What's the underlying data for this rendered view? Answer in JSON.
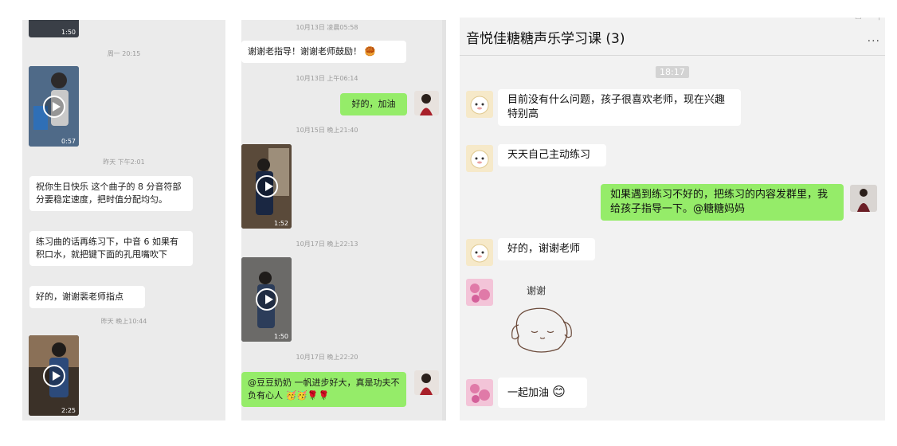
{
  "panel1": {
    "video_top": {
      "duration": "1:50"
    },
    "ts1": "周一 20:15",
    "video_a": {
      "duration": "0:57"
    },
    "ts2": "昨天 下午2:01",
    "msg1": "祝你生日快乐  这个曲子的 8 分音符部分要稳定速度，把时值分配均匀。",
    "msg2": "练习曲的话再练习下，中音 6 如果有积口水，就把键下面的孔甩嘴吹下",
    "msg3": "好的，谢谢裴老师指点",
    "ts3": "昨天 晚上10:44",
    "video_b": {
      "duration": "2:25"
    }
  },
  "panel2": {
    "ts1": "10月13日 凌晨05:58",
    "msg1": "谢谢老指导！谢谢老师鼓励！",
    "msg1_emoji": "🥮",
    "ts2": "10月13日 上午06:14",
    "msg2": "好的，加油",
    "ts3": "10月15日 晚上21:40",
    "video_a": {
      "duration": "1:52"
    },
    "ts4": "10月17日 晚上22:13",
    "video_b": {
      "duration": "1:50"
    },
    "ts5": "10月17日 晚上22:20",
    "msg3": "@豆豆奶奶  一帆进步好大，真是功夫不负有心人",
    "msg3_emojis": "🥳🥳🌹🌹"
  },
  "panel3": {
    "title": "音悦佳糖糖声乐学习课 (3)",
    "more": "...",
    "timestamp": "18:17",
    "msg1": "目前没有什么问题，孩子很喜欢老师，现在兴趣特别高",
    "msg2": "天天自己主动练习",
    "msg3": "如果遇到练习不好的，把练习的内容发群里，我给孩子指导一下。@糖糖妈妈",
    "msg4": "好的，谢谢老师",
    "sticker_text": "谢谢",
    "msg5": "一起加油",
    "msg5_emoji": "😊"
  },
  "colors": {
    "green_bubble": "#95ec69",
    "panel_bg": "#ebebeb"
  }
}
